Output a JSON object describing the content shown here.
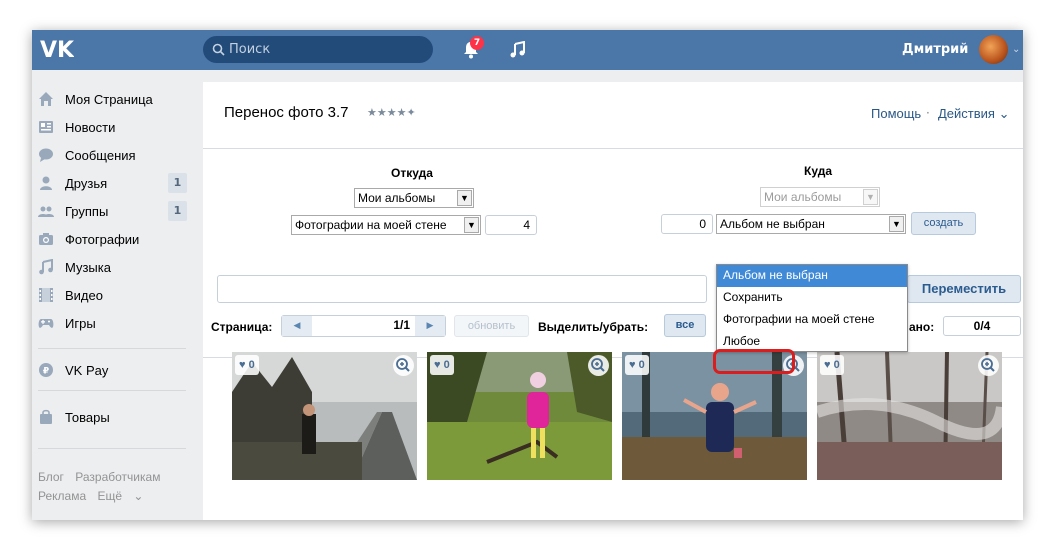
{
  "header": {
    "search_placeholder": "Поиск",
    "notification_count": "7",
    "user_name": "Дмитрий"
  },
  "sidebar": {
    "items": [
      {
        "label": "Моя Страница",
        "icon": "home-icon",
        "count": ""
      },
      {
        "label": "Новости",
        "icon": "news-icon",
        "count": ""
      },
      {
        "label": "Сообщения",
        "icon": "messages-icon",
        "count": ""
      },
      {
        "label": "Друзья",
        "icon": "friends-icon",
        "count": "1"
      },
      {
        "label": "Группы",
        "icon": "groups-icon",
        "count": "1"
      },
      {
        "label": "Фотографии",
        "icon": "camera-icon",
        "count": ""
      },
      {
        "label": "Музыка",
        "icon": "music-icon",
        "count": ""
      },
      {
        "label": "Видео",
        "icon": "video-icon",
        "count": ""
      },
      {
        "label": "Игры",
        "icon": "gamepad-icon",
        "count": ""
      },
      {
        "label": "VK Pay",
        "icon": "vkpay-icon",
        "count": ""
      },
      {
        "label": "Товары",
        "icon": "bag-icon",
        "count": ""
      }
    ],
    "footer": {
      "blog": "Блог",
      "developers": "Разработчикам",
      "ads": "Реклама",
      "more": "Ещё"
    }
  },
  "app": {
    "title": "Перенос фото 3.7",
    "stars": "★★★★✦",
    "help": "Помощь",
    "actions": "Действия",
    "from": {
      "heading": "Откуда",
      "source": "Мои альбомы",
      "album": "Фотографии на моей стене",
      "count": "4"
    },
    "to": {
      "heading": "Куда",
      "source": "Мои альбомы",
      "count": "0",
      "album": "Альбом не выбран",
      "create_label": "создать"
    },
    "move_label": "Переместить",
    "page_label": "Страница:",
    "page_value": "1/1",
    "refresh_label": "обновить",
    "select_label": "Выделить/убрать:",
    "all_label": "все",
    "selected_suffix": "ано:",
    "selected_count": "0/4",
    "dropdown_options": [
      "Альбом не выбран",
      "Сохранить",
      "Фотографии на моей стене",
      "Любое"
    ],
    "dropdown_active_index": 0
  },
  "photos": [
    {
      "likes": "0"
    },
    {
      "likes": "0"
    },
    {
      "likes": "0"
    },
    {
      "likes": "0"
    }
  ],
  "colors": {
    "header_bg": "#4a76a8",
    "link": "#2a5885",
    "dropdown_highlight": "#3f89d7",
    "annotation_red": "#d81e1e"
  }
}
